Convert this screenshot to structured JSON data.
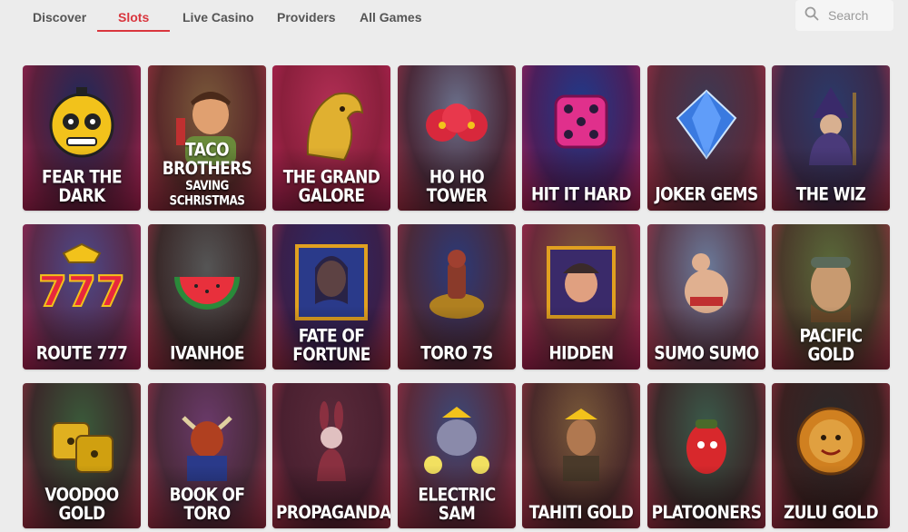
{
  "nav": {
    "tabs": [
      {
        "label": "Discover"
      },
      {
        "label": "Slots"
      },
      {
        "label": "Live Casino"
      },
      {
        "label": "Providers"
      },
      {
        "label": "All Games"
      }
    ],
    "active_tab": "Slots"
  },
  "search": {
    "placeholder": "Search",
    "icon": "search-icon"
  },
  "colors": {
    "accent": "#d9363e",
    "background": "#ececec"
  },
  "games": [
    {
      "title": "FEAR THE DARK",
      "subtitle": "",
      "bg": [
        "#1d2a5c",
        "#5a1f3c",
        "#c2255c"
      ],
      "art": "skull"
    },
    {
      "title": "TACO BROTHERS",
      "subtitle": "SAVING SCHRISTMAS",
      "bg": [
        "#7a5a3a",
        "#5a2a2a",
        "#b8334c"
      ],
      "art": "man"
    },
    {
      "title": "THE GRAND",
      "subtitle": "GALORE",
      "bg": [
        "#b22f55",
        "#8a1f3c",
        "#c2255c"
      ],
      "art": "jaguar",
      "two_line_big": true
    },
    {
      "title": "HO HO TOWER",
      "subtitle": "",
      "bg": [
        "#6a6f8a",
        "#4a2a3a",
        "#b8334c"
      ],
      "art": "flower"
    },
    {
      "title": "HIT IT HARD",
      "subtitle": "",
      "bg": [
        "#1e3a8a",
        "#4a1f5c",
        "#c2255c"
      ],
      "art": "dice"
    },
    {
      "title": "JOKER GEMS",
      "subtitle": "",
      "bg": [
        "#3a3a55",
        "#5a2a3a",
        "#b8334c"
      ],
      "art": "gem"
    },
    {
      "title": "THE WIZ",
      "subtitle": "",
      "bg": [
        "#2a3a6a",
        "#3a2a4a",
        "#b8334c"
      ],
      "art": "wizard"
    },
    {
      "title": "ROUTE 777",
      "subtitle": "",
      "bg": [
        "#4a4a8a",
        "#5a2a4a",
        "#c2255c"
      ],
      "art": "sevens"
    },
    {
      "title": "IVANHOE",
      "subtitle": "",
      "bg": [
        "#555555",
        "#3a2a2a",
        "#b8334c"
      ],
      "art": "melon"
    },
    {
      "title": "FATE OF FORTUNE",
      "subtitle": "",
      "bg": [
        "#2a2a6a",
        "#3a1f4a",
        "#b8334c"
      ],
      "art": "woman"
    },
    {
      "title": "TORO 7S",
      "subtitle": "",
      "bg": [
        "#2a3a7a",
        "#4a2a3a",
        "#b8334c"
      ],
      "art": "rider"
    },
    {
      "title": "HIDDEN",
      "subtitle": "",
      "bg": [
        "#7a5a3a",
        "#6a2a3a",
        "#c2255c"
      ],
      "art": "boy"
    },
    {
      "title": "SUMO SUMO",
      "subtitle": "",
      "bg": [
        "#6a7a9a",
        "#5a3a4a",
        "#b8334c"
      ],
      "art": "sumo"
    },
    {
      "title": "PACIFIC GOLD",
      "subtitle": "",
      "bg": [
        "#5a6a3a",
        "#4a3a2a",
        "#b8334c"
      ],
      "art": "pilot"
    },
    {
      "title": "VOODOO GOLD",
      "subtitle": "",
      "bg": [
        "#3a5a3a",
        "#3a2a2a",
        "#b8334c"
      ],
      "art": "golddice"
    },
    {
      "title": "BOOK OF TORO",
      "subtitle": "",
      "bg": [
        "#6a3a6a",
        "#4a2a3a",
        "#b8334c"
      ],
      "art": "minotaur"
    },
    {
      "title": "PROPAGANDA",
      "subtitle": "",
      "bg": [
        "#5a2a3a",
        "#4a2030",
        "#b8334c"
      ],
      "art": "bunny"
    },
    {
      "title": "ELECTRIC SAM",
      "subtitle": "",
      "bg": [
        "#3a4a7a",
        "#5a2a3a",
        "#b8334c"
      ],
      "art": "sam"
    },
    {
      "title": "TAHITI GOLD",
      "subtitle": "",
      "bg": [
        "#7a5a3a",
        "#4a2a2a",
        "#b8334c"
      ],
      "art": "warrior"
    },
    {
      "title": "PLATOONERS",
      "subtitle": "",
      "bg": [
        "#3a5a4a",
        "#3a2a2a",
        "#b8334c"
      ],
      "art": "pepper"
    },
    {
      "title": "ZULU GOLD",
      "subtitle": "",
      "bg": [
        "#2a2a2a",
        "#3a2020",
        "#b8334c"
      ],
      "art": "lion"
    }
  ]
}
